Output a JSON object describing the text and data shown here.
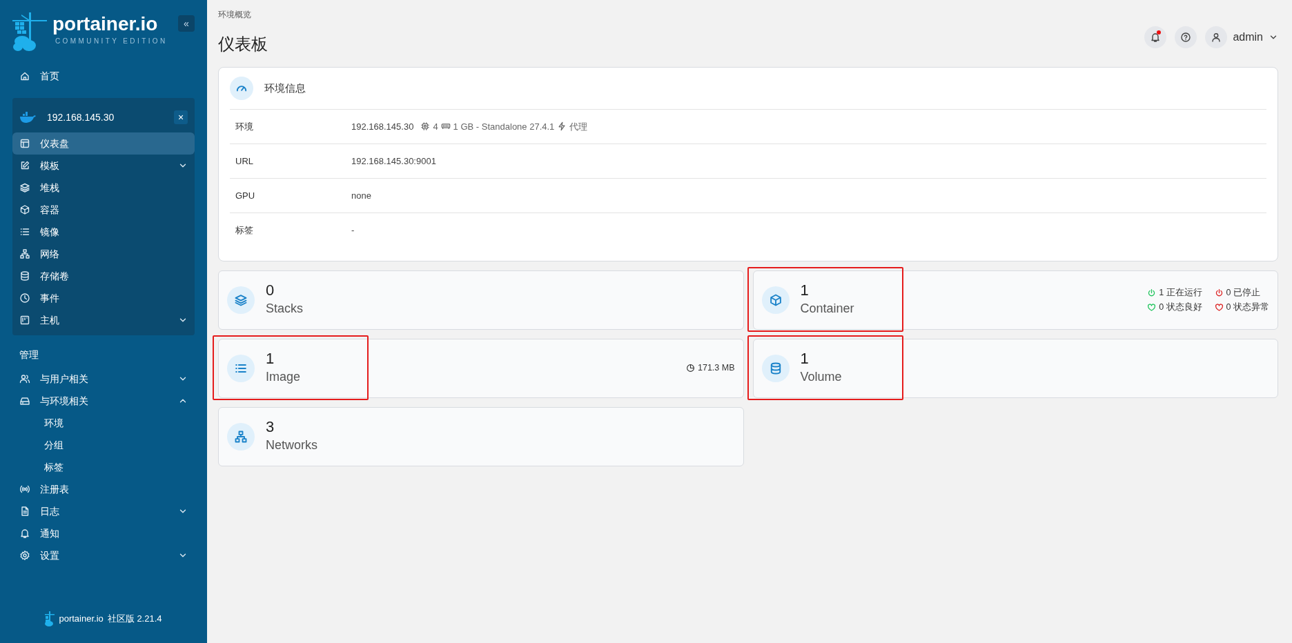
{
  "sidebar": {
    "logo": {
      "name": "portainer.io",
      "edition": "COMMUNITY EDITION"
    },
    "collapse_button": "«",
    "home": {
      "label": "首页",
      "selected": false
    },
    "environment": {
      "name": "192.168.145.30",
      "close": "×",
      "items": [
        {
          "label": "仪表盘",
          "selected": true
        },
        {
          "label": "模板",
          "selected": false,
          "expanded": false
        },
        {
          "label": "堆栈",
          "selected": false
        },
        {
          "label": "容器",
          "selected": false
        },
        {
          "label": "镜像",
          "selected": false
        },
        {
          "label": "网络",
          "selected": false
        },
        {
          "label": "存储卷",
          "selected": false
        },
        {
          "label": "事件",
          "selected": false
        },
        {
          "label": "主机",
          "selected": false,
          "expanded": false
        }
      ]
    },
    "section_title": "管理",
    "items": [
      {
        "label": "与用户相关",
        "selected": false,
        "expanded": false
      },
      {
        "label": "与环境相关",
        "selected": false,
        "expanded": true,
        "children": [
          {
            "label": "环境",
            "selected": false
          },
          {
            "label": "分组",
            "selected": false
          },
          {
            "label": "标签",
            "selected": false
          }
        ]
      },
      {
        "label": "注册表",
        "selected": false
      },
      {
        "label": "日志",
        "selected": false,
        "expanded": false
      },
      {
        "label": "通知",
        "selected": false
      },
      {
        "label": "设置",
        "selected": false,
        "expanded": false
      }
    ],
    "footer": {
      "name": "portainer.io",
      "version": "社区版 2.21.4"
    }
  },
  "header": {
    "breadcrumb": "环境概览",
    "title": "仪表板",
    "notification_unread": true,
    "user": "admin"
  },
  "environment_info": {
    "title": "环境信息",
    "rows": [
      {
        "label": "环境",
        "values": [
          "192.168.145.30",
          "4",
          "1 GB - Standalone 27.4.1",
          "代理"
        ]
      },
      {
        "label": "URL",
        "values": [
          "192.168.145.30:9001"
        ]
      },
      {
        "label": "GPU",
        "values": [
          "none"
        ]
      },
      {
        "label": "标签",
        "values": [
          "-"
        ]
      }
    ]
  },
  "tiles": [
    {
      "kind": "stacks",
      "count": "0",
      "label": "Stacks",
      "highlighted": false
    },
    {
      "kind": "containers",
      "count": "1",
      "label": "Container",
      "highlighted": true,
      "stats": [
        {
          "kind": "power",
          "text": "1 正在运行",
          "color": "#22c55e"
        },
        {
          "kind": "power",
          "text": "0 已停止",
          "color": "#dc2626"
        },
        {
          "kind": "heart",
          "text": "0 状态良好",
          "color": "#22c55e"
        },
        {
          "kind": "heart",
          "text": "0 状态异常",
          "color": "#dc2626"
        }
      ]
    },
    {
      "kind": "images",
      "count": "1",
      "label": "Image",
      "highlighted": true,
      "size": "171.3 MB"
    },
    {
      "kind": "volumes",
      "count": "1",
      "label": "Volume",
      "highlighted": true
    },
    {
      "kind": "networks",
      "count": "3",
      "label": "Networks",
      "highlighted": false
    }
  ]
}
